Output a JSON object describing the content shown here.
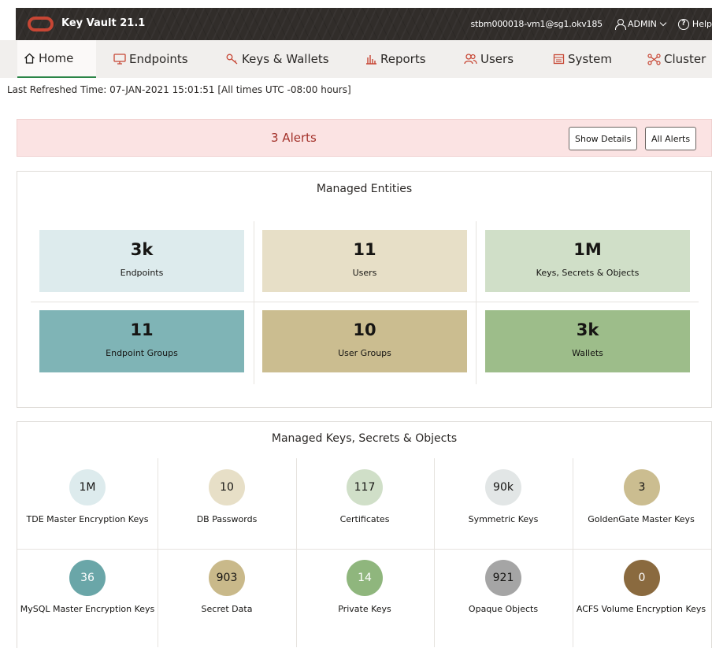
{
  "app": {
    "title": "Key Vault 21.1"
  },
  "header": {
    "host": "stbm000018-vm1@sg1.okv185",
    "user_label": "ADMIN",
    "help_label": "Help"
  },
  "nav": {
    "tabs": [
      {
        "label": "Home",
        "icon": "home-icon",
        "active": true
      },
      {
        "label": "Endpoints",
        "icon": "monitor-icon"
      },
      {
        "label": "Keys & Wallets",
        "icon": "key-icon"
      },
      {
        "label": "Reports",
        "icon": "bar-chart-icon"
      },
      {
        "label": "Users",
        "icon": "users-icon"
      },
      {
        "label": "System",
        "icon": "system-icon"
      },
      {
        "label": "Cluster",
        "icon": "cluster-icon"
      }
    ]
  },
  "refresh": {
    "text": "Last Refreshed Time: 07-JAN-2021 15:01:51 [All times UTC -08:00 hours]"
  },
  "alerts": {
    "text": "3 Alerts",
    "show_details": "Show Details",
    "all_alerts": "All Alerts",
    "bg_color": "#fbe3e3"
  },
  "entities": {
    "title": "Managed Entities",
    "tiles": [
      {
        "value": "3k",
        "label": "Endpoints",
        "color": "#ddebed"
      },
      {
        "value": "11",
        "label": "Users",
        "color": "#e7dfc7"
      },
      {
        "value": "1M",
        "label": "Keys, Secrets & Objects",
        "color": "#d0dfc8"
      },
      {
        "value": "11",
        "label": "Endpoint Groups",
        "color": "#7fb4b6"
      },
      {
        "value": "10",
        "label": "User Groups",
        "color": "#cbbd90"
      },
      {
        "value": "3k",
        "label": "Wallets",
        "color": "#9dbd8a"
      }
    ]
  },
  "objects": {
    "title": "Managed Keys, Secrets & Objects",
    "items": [
      {
        "value": "1M",
        "label": "TDE Master Encryption Keys",
        "color": "#ddebed",
        "text_color": "#161513"
      },
      {
        "value": "10",
        "label": "DB Passwords",
        "color": "#e7dfc7",
        "text_color": "#161513"
      },
      {
        "value": "117",
        "label": "Certificates",
        "color": "#d0dfc8",
        "text_color": "#161513"
      },
      {
        "value": "90k",
        "label": "Symmetric Keys",
        "color": "#e2e6e6",
        "text_color": "#161513"
      },
      {
        "value": "3",
        "label": "GoldenGate Master Keys",
        "color": "#cbbd90",
        "text_color": "#161513"
      },
      {
        "value": "36",
        "label": "MySQL Master Encryption Keys",
        "color": "#6aa6a8",
        "text_color": "#ffffff"
      },
      {
        "value": "903",
        "label": "Secret Data",
        "color": "#c9b98a",
        "text_color": "#161513"
      },
      {
        "value": "14",
        "label": "Private Keys",
        "color": "#8fb67d",
        "text_color": "#ffffff"
      },
      {
        "value": "921",
        "label": "Opaque Objects",
        "color": "#a5a5a5",
        "text_color": "#161513"
      },
      {
        "value": "0",
        "label": "ACFS Volume Encryption Keys",
        "color": "#8a6a3f",
        "text_color": "#ffffff"
      }
    ]
  }
}
